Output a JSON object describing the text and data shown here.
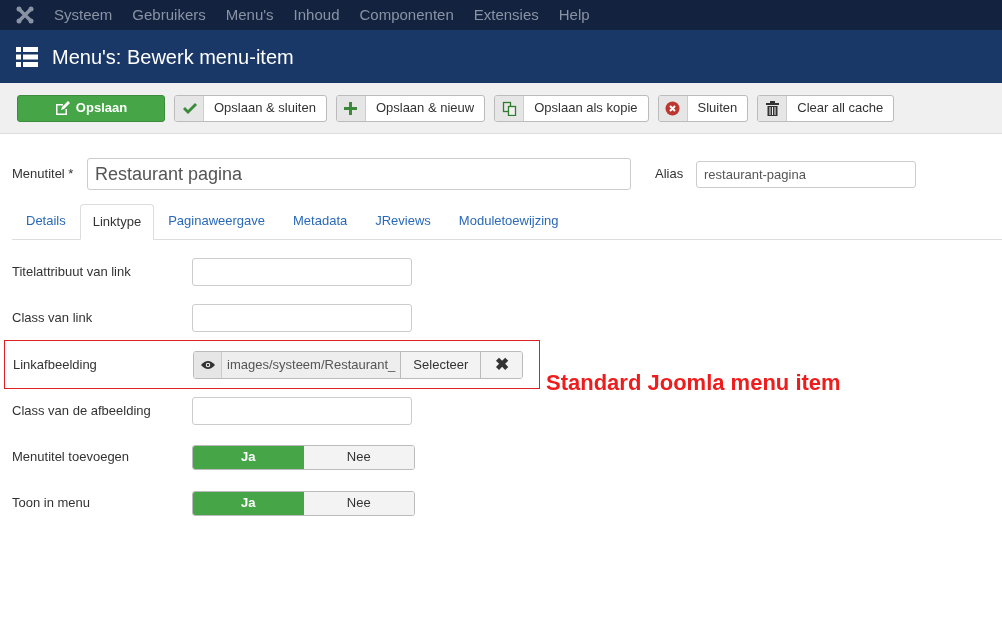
{
  "top_menu": [
    "Systeem",
    "Gebruikers",
    "Menu's",
    "Inhoud",
    "Componenten",
    "Extensies",
    "Help"
  ],
  "header": {
    "title": "Menu's: Bewerk menu-item"
  },
  "toolbar": [
    {
      "label": "Opslaan",
      "kind": "edit",
      "primary": true
    },
    {
      "label": "Opslaan & sluiten",
      "kind": "check",
      "primary": false
    },
    {
      "label": "Opslaan & nieuw",
      "kind": "plus",
      "primary": false
    },
    {
      "label": "Opslaan als kopie",
      "kind": "copy",
      "primary": false
    },
    {
      "label": "Sluiten",
      "kind": "close",
      "primary": false
    },
    {
      "label": "Clear all cache",
      "kind": "trash",
      "primary": false
    }
  ],
  "title_field": {
    "label": "Menutitel *",
    "value": "Restaurant pagina"
  },
  "alias_field": {
    "label": "Alias",
    "value": "restaurant-pagina"
  },
  "tabs": [
    {
      "label": "Details",
      "selected": false
    },
    {
      "label": "Linktype",
      "selected": true
    },
    {
      "label": "Paginaweergave",
      "selected": false
    },
    {
      "label": "Metadata",
      "selected": false
    },
    {
      "label": "JReviews",
      "selected": false
    },
    {
      "label": "Moduletoewijzing",
      "selected": false
    }
  ],
  "fields": [
    {
      "kind": "text",
      "label": "Titelattribuut van link"
    },
    {
      "kind": "text",
      "label": "Class van link"
    },
    {
      "kind": "media",
      "label": "Linkafbeelding",
      "value": "images/systeem/Restaurant_",
      "button": "Selecteer",
      "clear": "✖",
      "highlighted": true
    },
    {
      "kind": "text",
      "label": "Class van de afbeelding"
    },
    {
      "kind": "toggle",
      "label": "Menutitel toevoegen",
      "options": [
        {
          "label": "Ja",
          "selected": true
        },
        {
          "label": "Nee",
          "selected": false
        }
      ]
    },
    {
      "kind": "toggle",
      "label": "Toon in menu",
      "options": [
        {
          "label": "Ja",
          "selected": true
        },
        {
          "label": "Nee",
          "selected": false
        }
      ]
    }
  ],
  "annotation": "Standard Joomla menu item"
}
